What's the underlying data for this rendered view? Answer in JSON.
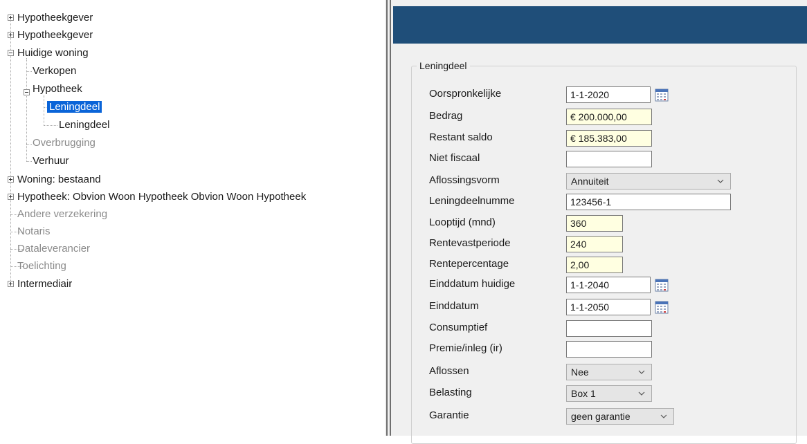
{
  "tree": {
    "nodes": [
      {
        "label": "Hypotheekgever",
        "state": "collapsed"
      },
      {
        "label": "Hypotheekgever",
        "state": "collapsed"
      },
      {
        "label": "Huidige woning",
        "state": "expanded"
      },
      {
        "label": "Verkopen"
      },
      {
        "label": "Hypotheek",
        "state": "expanded"
      },
      {
        "label": "Leningdeel",
        "selected": true
      },
      {
        "label": "Leningdeel"
      },
      {
        "label": "Overbrugging",
        "disabled": true
      },
      {
        "label": "Verhuur"
      },
      {
        "label": "Woning: bestaand",
        "state": "collapsed"
      },
      {
        "label": "Hypotheek: Obvion Woon Hypotheek Obvion Woon Hypotheek",
        "state": "collapsed"
      },
      {
        "label": "Andere verzekering",
        "disabled": true
      },
      {
        "label": "Notaris",
        "disabled": true
      },
      {
        "label": "Dataleverancier",
        "disabled": true
      },
      {
        "label": "Toelichting",
        "disabled": true
      },
      {
        "label": "Intermediair",
        "state": "collapsed"
      }
    ]
  },
  "form": {
    "group_title": "Leningdeel",
    "fields": [
      {
        "label": "Oorspronkelijke",
        "value": "1-1-2020",
        "type": "date"
      },
      {
        "label": "Bedrag",
        "value": "€ 200.000,00",
        "type": "text-yellow"
      },
      {
        "label": "Restant saldo",
        "value": "€ 185.383,00",
        "type": "text-yellow"
      },
      {
        "label": "Niet fiscaal",
        "value": "",
        "type": "text"
      },
      {
        "label": "Aflossingsvorm",
        "value": "Annuiteit",
        "type": "combo"
      },
      {
        "label": "Leningdeelnumme",
        "value": "123456-1",
        "type": "text"
      },
      {
        "label": "Looptijd (mnd)",
        "value": "360",
        "type": "text-yellow"
      },
      {
        "label": "Rentevastperiode",
        "value": "240",
        "type": "text-yellow"
      },
      {
        "label": "Rentepercentage",
        "value": "2,00",
        "type": "text-yellow"
      },
      {
        "label": "Einddatum huidige",
        "value": "1-1-2040",
        "type": "date"
      },
      {
        "label": "Einddatum",
        "value": "1-1-2050",
        "type": "date"
      },
      {
        "label": "Consumptief",
        "value": "",
        "type": "text"
      },
      {
        "label": "Premie/inleg (ir)",
        "value": "",
        "type": "text"
      },
      {
        "label": "Aflossen",
        "value": "Nee",
        "type": "combo"
      },
      {
        "label": "Belasting",
        "value": "Box 1",
        "type": "combo"
      },
      {
        "label": "Garantie",
        "value": "geen garantie",
        "type": "combo"
      }
    ]
  },
  "colors": {
    "header": "#1f4e79",
    "selection": "#0a64d8",
    "required_field": "#ffffe1",
    "panel_bg": "#f0f0f0"
  }
}
